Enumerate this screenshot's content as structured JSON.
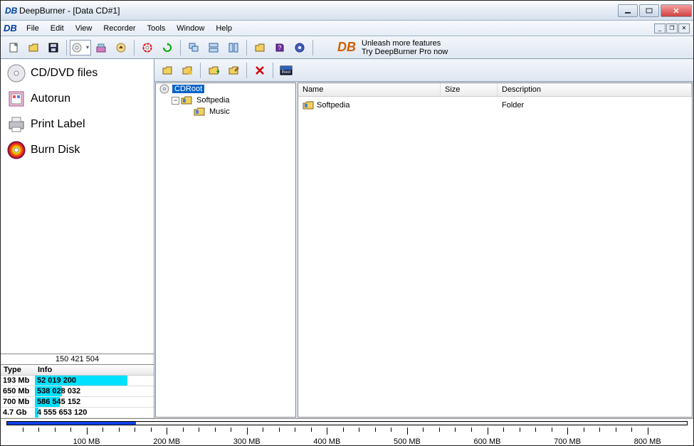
{
  "window": {
    "title": "DeepBurner - [Data CD#1]"
  },
  "menu": {
    "items": [
      "File",
      "Edit",
      "View",
      "Recorder",
      "Tools",
      "Window",
      "Help"
    ]
  },
  "promo": {
    "line1": "Unleash more features",
    "line2": "Try DeepBurner Pro now"
  },
  "nav": {
    "items": [
      {
        "label": "CD/DVD files",
        "icon": "cd"
      },
      {
        "label": "Autorun",
        "icon": "autorun"
      },
      {
        "label": "Print Label",
        "icon": "printer"
      },
      {
        "label": "Burn Disk",
        "icon": "burn"
      }
    ]
  },
  "info": {
    "total": "150 421 504",
    "headers": {
      "type": "Type",
      "info": "Info"
    },
    "rows": [
      {
        "type": "193 Mb",
        "info": "52 019 200",
        "fill": 78
      },
      {
        "type": "650 Mb",
        "info": "538 028 032",
        "fill": 23
      },
      {
        "type": "700 Mb",
        "info": "586 545 152",
        "fill": 21
      },
      {
        "type": "4.7 Gb",
        "info": "4 555 653 120",
        "fill": 3
      }
    ]
  },
  "tree": {
    "nodes": [
      {
        "label": "CDRoot",
        "depth": 0,
        "icon": "cd",
        "selected": true,
        "toggle": null
      },
      {
        "label": "Softpedia",
        "depth": 1,
        "icon": "folder",
        "selected": false,
        "toggle": "minus"
      },
      {
        "label": "Music",
        "depth": 2,
        "icon": "folder",
        "selected": false,
        "toggle": null
      }
    ]
  },
  "filelist": {
    "cols": {
      "name": "Name",
      "size": "Size",
      "desc": "Description"
    },
    "rows": [
      {
        "name": "Softpedia",
        "size": "",
        "desc": "Folder",
        "icon": "folder"
      }
    ]
  },
  "ruler": {
    "labels": [
      "100 MB",
      "200 MB",
      "300 MB",
      "400 MB",
      "500 MB",
      "600 MB",
      "700 MB",
      "800 MB"
    ],
    "fill_percent": 19
  }
}
